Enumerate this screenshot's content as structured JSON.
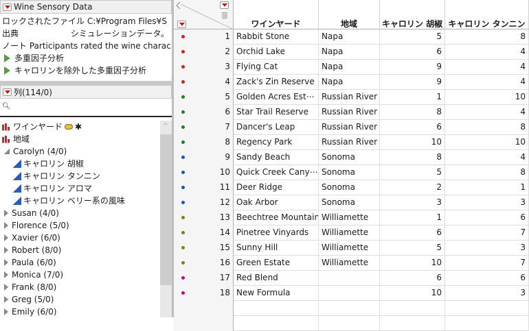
{
  "panel": {
    "title": "Wine Sensory Data",
    "info": [
      {
        "label": "ロックされたファイル",
        "value": "C:¥Program Files¥S"
      },
      {
        "label": "出典",
        "value": "シミュレーションデータ。"
      },
      {
        "label": "ノート",
        "value": "Participants rated the wine charac"
      }
    ],
    "scripts": [
      "多重因子分析",
      "キャロリンを除外した多重因子分析"
    ]
  },
  "columns_panel": {
    "title": "列(114/0)",
    "search_placeholder": ""
  },
  "column_list": [
    {
      "label": "ワインヤード",
      "type": "nominal",
      "extra": "✱"
    },
    {
      "label": "地域",
      "type": "nominal"
    },
    {
      "label": "Carolyn (4/0)",
      "type": "group-open"
    },
    {
      "label": "キャロリン 胡椒",
      "type": "continuous"
    },
    {
      "label": "キャロリン タンニン",
      "type": "continuous"
    },
    {
      "label": "キャロリン アロマ",
      "type": "continuous"
    },
    {
      "label": "キャロリン ベリー系の風味",
      "type": "continuous"
    },
    {
      "label": "Susan (4/0)",
      "type": "group"
    },
    {
      "label": "Florence (5/0)",
      "type": "group"
    },
    {
      "label": "Xavier (6/0)",
      "type": "group"
    },
    {
      "label": "Robert (8/0)",
      "type": "group"
    },
    {
      "label": "Paula (6/0)",
      "type": "group"
    },
    {
      "label": "Monica (7/0)",
      "type": "group"
    },
    {
      "label": "Frank (8/0)",
      "type": "group"
    },
    {
      "label": "Greg (5/0)",
      "type": "group"
    },
    {
      "label": "Emily (6/0)",
      "type": "group"
    }
  ],
  "table": {
    "headers": [
      "ワインヤード",
      "地域",
      "キャロリン 胡椒",
      "キャロリン タンニン"
    ],
    "colors": {
      "Napa": "#d0202a",
      "Russian River": "#1f7a2a",
      "Sonoma": "#2050c0",
      "Williamette": "#8a7a10",
      "none": "#b0107a"
    },
    "rows": [
      [
        1,
        "Rabbit Stone",
        "Napa",
        5,
        8
      ],
      [
        2,
        "Orchid Lake",
        "Napa",
        6,
        4
      ],
      [
        3,
        "Flying Cat",
        "Napa",
        9,
        4
      ],
      [
        4,
        "Zack's Zin Reserve",
        "Napa",
        9,
        4
      ],
      [
        5,
        "Golden Acres Est⋯",
        "Russian River",
        1,
        10
      ],
      [
        6,
        "Star Trail Reserve",
        "Russian River",
        8,
        4
      ],
      [
        7,
        "Dancer's Leap",
        "Russian River",
        6,
        8
      ],
      [
        8,
        "Regency Park",
        "Russian River",
        10,
        10
      ],
      [
        9,
        "Sandy Beach",
        "Sonoma",
        8,
        4
      ],
      [
        10,
        "Quick Creek Cany⋯",
        "Sonoma",
        5,
        8
      ],
      [
        11,
        "Deer Ridge",
        "Sonoma",
        2,
        1
      ],
      [
        12,
        "Oak Arbor",
        "Sonoma",
        3,
        3
      ],
      [
        13,
        "Beechtree Mountain",
        "Williamette",
        1,
        6
      ],
      [
        14,
        "Pinetree Vinyards",
        "Williamette",
        6,
        7
      ],
      [
        15,
        "Sunny Hill",
        "Williamette",
        5,
        3
      ],
      [
        16,
        "Green Estate",
        "Williamette",
        10,
        7
      ],
      [
        17,
        "Red Blend",
        "",
        6,
        6
      ],
      [
        18,
        "New Formula",
        "",
        10,
        3
      ]
    ]
  }
}
